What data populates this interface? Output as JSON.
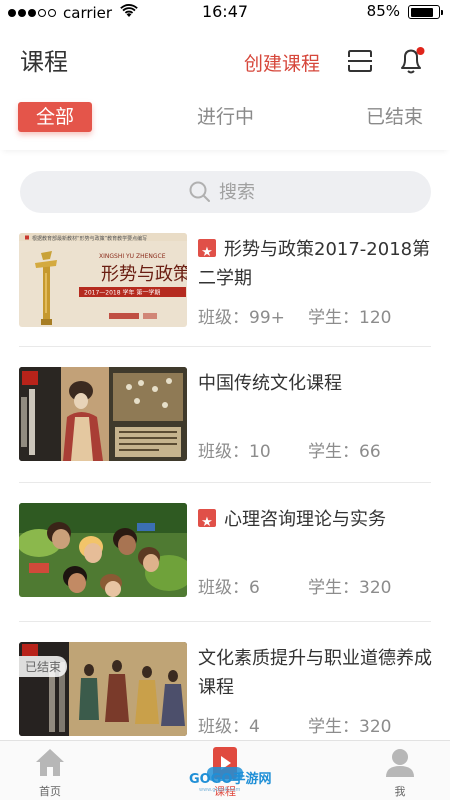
{
  "status_bar": {
    "carrier": "carrier",
    "time": "16:47",
    "battery": "85%",
    "battery_level": 0.85
  },
  "header": {
    "title": "课程",
    "create_label": "创建课程"
  },
  "tabs": [
    {
      "label": "全部",
      "active": true
    },
    {
      "label": "进行中",
      "active": false
    },
    {
      "label": "已结束",
      "active": false
    }
  ],
  "search": {
    "placeholder": "搜索"
  },
  "courses": [
    {
      "title": "形势与政策2017-2018第二学期",
      "starred": true,
      "class_label": "班级：",
      "class_value": "99+",
      "student_label": "学生：",
      "student_value": "120"
    },
    {
      "title": "中国传统文化课程",
      "starred": false,
      "class_label": "班级：",
      "class_value": "10",
      "student_label": "学生：",
      "student_value": "66"
    },
    {
      "title": "心理咨询理论与实务",
      "starred": true,
      "class_label": "班级：",
      "class_value": "6",
      "student_label": "学生：",
      "student_value": "320"
    },
    {
      "title": "文化素质提升与职业道德养成课程",
      "starred": false,
      "ended_badge": "已结束",
      "class_label": "班级：",
      "class_value": "4",
      "student_label": "学生：",
      "student_value": "320"
    }
  ],
  "thumb1": {
    "top": "根据教育部最新教材“形势与政策”教育教学要点编写",
    "pinyin": "XINGSHI YU ZHENGCE",
    "title": "形势与政策",
    "banner": "2017—2018 学年  第一学期"
  },
  "tabbar": [
    {
      "label": "首页",
      "icon": "home-icon"
    },
    {
      "label": "课程",
      "icon": "course-icon"
    },
    {
      "label": "我",
      "icon": "person-icon"
    }
  ],
  "watermark": {
    "text": "GOGO手游网",
    "url": "www.gogo8.com"
  },
  "colors": {
    "accent": "#e4554a",
    "accent_text": "#d6473b",
    "muted": "#8c8c8c"
  }
}
